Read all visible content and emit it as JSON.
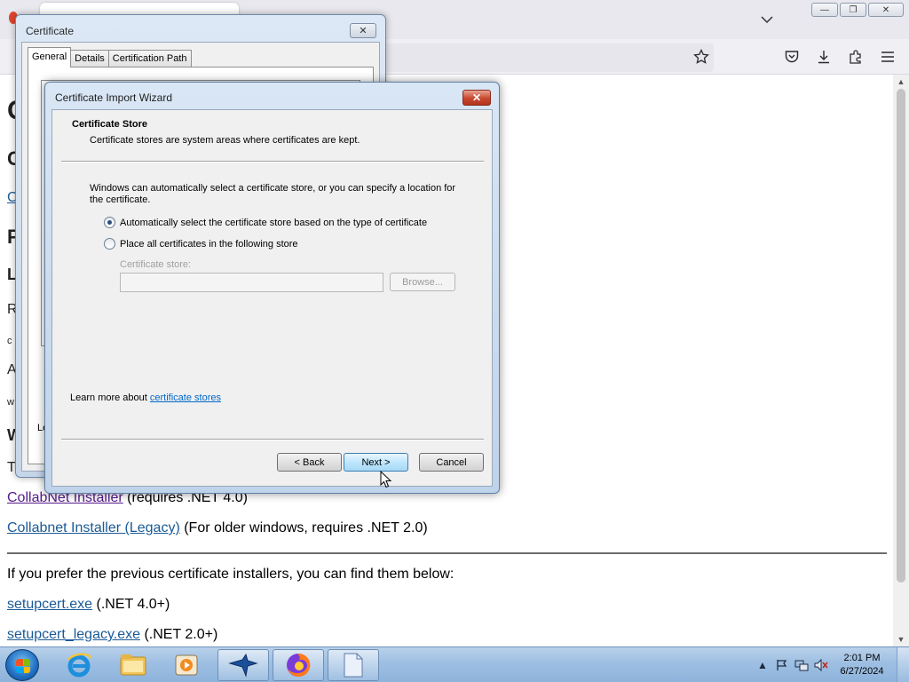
{
  "browser": {
    "window_buttons": {
      "minimize": "—",
      "restore": "❐",
      "close": "✕"
    },
    "tab_list_icon": "chevron-down-icon",
    "toolbar_icons": [
      "bookmark-star-icon",
      "pocket-icon",
      "downloads-icon",
      "extensions-icon",
      "menu-icon"
    ]
  },
  "page": {
    "links": [
      {
        "text": "CollabNet Installer",
        "suffix": " (requires .NET 4.0)"
      },
      {
        "text": "Collabnet Installer (Legacy)",
        "suffix": " (For older windows, requires .NET 2.0)"
      }
    ],
    "previous_text": "If you prefer the previous certificate installers, you can find them below:",
    "downloads": [
      {
        "text": "setupcert.exe",
        "suffix": " (.NET 4.0+)"
      },
      {
        "text": "setupcert_legacy.exe",
        "suffix": " (.NET 2.0+)"
      }
    ],
    "fragments": [
      "C",
      "C",
      "C",
      "F",
      "L",
      "R",
      "c",
      "A",
      "w",
      "W",
      "T"
    ]
  },
  "certificate_dialog": {
    "title": "Certificate",
    "close": "✕",
    "tabs": [
      "General",
      "Details",
      "Certification Path"
    ],
    "active_tab": "General",
    "learn_fragment": "Le"
  },
  "wizard": {
    "title": "Certificate Import Wizard",
    "close": "✕",
    "header_title": "Certificate Store",
    "header_subtitle": "Certificate stores are system areas where certificates are kept.",
    "description": "Windows can automatically select a certificate store, or you can specify a location for the certificate.",
    "option_auto": "Automatically select the certificate store based on the type of certificate",
    "option_manual": "Place all certificates in the following store",
    "selected_option": "auto",
    "store_label": "Certificate store:",
    "store_value": "",
    "browse_label": "Browse...",
    "learn_prefix": "Learn more about ",
    "learn_link": "certificate stores",
    "back_label": "< Back",
    "next_label": "Next >",
    "cancel_label": "Cancel"
  },
  "taskbar": {
    "items": [
      "internet-explorer-icon",
      "file-explorer-icon",
      "media-player-icon",
      "bird-app-icon",
      "firefox-icon",
      "notepad-icon"
    ],
    "time": "2:01 PM",
    "date": "6/27/2024"
  }
}
